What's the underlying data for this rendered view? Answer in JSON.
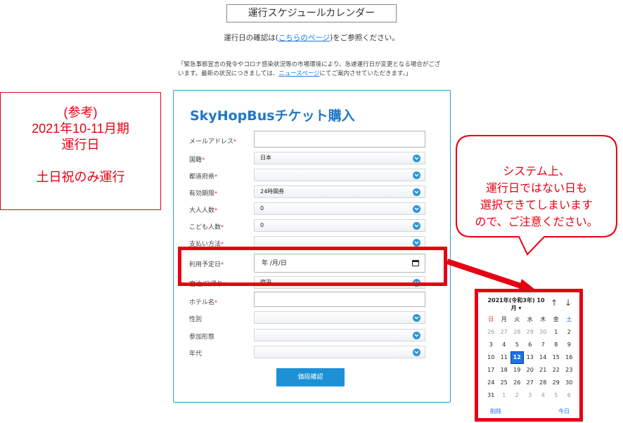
{
  "page": {
    "title": "運行スケジュールカレンダー",
    "subtitle_pre": "運行日の確認は(",
    "subtitle_link": "こちらのページ",
    "subtitle_post": ")をご参照ください。",
    "notice_pre": "「緊急事態宣言の発令やコロナ感染状況等の市場環境により、急遽運行日が変更となる場合がございます。最新の状況につきましては、",
    "notice_link": "ニュースページ",
    "notice_post": "にてご案内させていただきます。」"
  },
  "form": {
    "heading": "SkyHopBusチケット購入",
    "required_mark": "*",
    "fields": [
      {
        "label": "メールアドレス",
        "required": true,
        "type": "text",
        "value": ""
      },
      {
        "label": "国籍",
        "required": true,
        "type": "select",
        "value": "日本"
      },
      {
        "label": "都道府県",
        "required": true,
        "type": "select",
        "value": ""
      },
      {
        "label": "有効期限",
        "required": true,
        "type": "select",
        "value": "24時間券"
      },
      {
        "label": "大人人数",
        "required": true,
        "type": "select",
        "value": "0"
      },
      {
        "label": "こども人数",
        "required": true,
        "type": "select",
        "value": "0"
      },
      {
        "label": "支払い方法",
        "required": true,
        "type": "select",
        "value": ""
      },
      {
        "label": "利用予定日",
        "required": true,
        "type": "date",
        "value": "年 /月/日"
      },
      {
        "label": "宿泊/日帰り",
        "required": true,
        "type": "select",
        "value": "宿泊"
      },
      {
        "label": "ホテル名",
        "required": true,
        "type": "text",
        "value": ""
      },
      {
        "label": "性別",
        "required": false,
        "type": "select",
        "value": ""
      },
      {
        "label": "参加形態",
        "required": false,
        "type": "select",
        "value": ""
      },
      {
        "label": "年代",
        "required": false,
        "type": "select",
        "value": ""
      }
    ],
    "submit_label": "価段確認"
  },
  "reference_box": {
    "lines": [
      "(参考)",
      "2021年10-11月期",
      "運行日",
      "",
      "土日祝のみ運行"
    ],
    "color": "#e60012"
  },
  "callout": {
    "lines": [
      "システム上、",
      "運行日ではない日も",
      "選択できてしまいます",
      "ので、ご注意ください。"
    ],
    "color": "#e60012"
  },
  "calendar": {
    "header_line1": "2021年(令和3年) 10",
    "header_line2": "月 ▾",
    "prev_icon": "arrow-up-icon",
    "next_icon": "arrow-down-icon",
    "weekdays": [
      "日",
      "月",
      "火",
      "水",
      "木",
      "金",
      "土"
    ],
    "weeks": [
      [
        "26",
        "27",
        "28",
        "29",
        "30",
        "1",
        "2"
      ],
      [
        "3",
        "4",
        "5",
        "6",
        "7",
        "8",
        "9"
      ],
      [
        "10",
        "11",
        "12",
        "13",
        "14",
        "15",
        "16"
      ],
      [
        "17",
        "18",
        "19",
        "20",
        "21",
        "22",
        "23"
      ],
      [
        "24",
        "25",
        "26",
        "27",
        "28",
        "29",
        "30"
      ],
      [
        "31",
        "1",
        "2",
        "3",
        "4",
        "5",
        "6"
      ]
    ],
    "selected_day": "12",
    "clear_label": "削除",
    "today_label": "今日",
    "accent": "#1a73e8",
    "sunday_color": "#e0312f",
    "saturday_color": "#2a5bd7"
  },
  "colors": {
    "brand_blue": "#1f78c8",
    "border_blue": "#2e97d8",
    "highlight_red": "#e60012"
  }
}
